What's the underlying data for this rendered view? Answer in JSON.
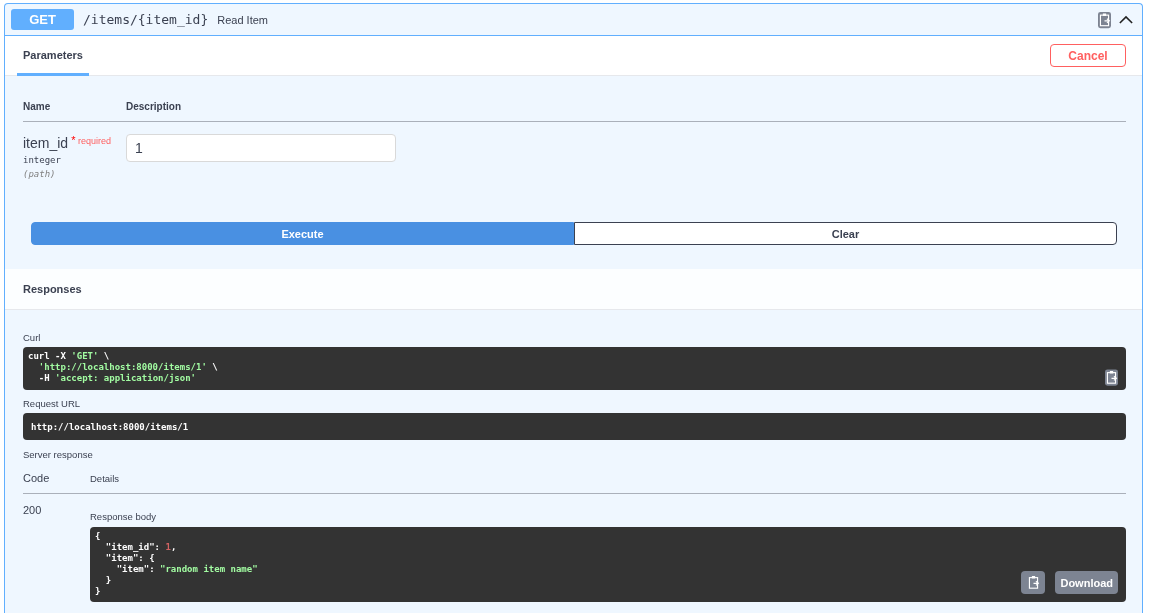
{
  "operation": {
    "method": "GET",
    "path": "/items/{item_id}",
    "summary": "Read Item",
    "expanded": true
  },
  "tabs": [
    {
      "label": "Parameters",
      "selected": true
    }
  ],
  "cancel_button": "Cancel",
  "parameters": {
    "columns": [
      "Name",
      "Description"
    ],
    "rows": [
      {
        "name": "item_id",
        "required_mark": "*",
        "required_label": "required",
        "type": "integer",
        "location": "(path)",
        "value": "1"
      }
    ]
  },
  "execute_button": "Execute",
  "clear_button": "Clear",
  "responses_title": "Responses",
  "curl": {
    "label": "Curl",
    "lines": [
      [
        {
          "text": "curl -X ",
          "kind": "plain"
        },
        {
          "text": "'GET'",
          "kind": "string"
        },
        {
          "text": " \\",
          "kind": "plain"
        }
      ],
      [
        {
          "text": "  'http://localhost:8000/items/1'",
          "kind": "string"
        },
        {
          "text": " \\",
          "kind": "plain"
        }
      ],
      [
        {
          "text": "  -H ",
          "kind": "plain"
        },
        {
          "text": "'accept: application/json'",
          "kind": "string"
        }
      ]
    ]
  },
  "request_url": {
    "label": "Request URL",
    "value": "http://localhost:8000/items/1"
  },
  "server_response": {
    "label": "Server response",
    "columns": [
      "Code",
      "Details"
    ],
    "rows": [
      {
        "code": "200",
        "body_label": "Response body",
        "download_button": "Download",
        "lines": [
          [
            {
              "text": "{",
              "kind": "plain"
            }
          ],
          [
            {
              "text": "  \"item_id\": ",
              "kind": "plain"
            },
            {
              "text": "1",
              "kind": "number"
            },
            {
              "text": ",",
              "kind": "plain"
            }
          ],
          [
            {
              "text": "  \"item\": {",
              "kind": "plain"
            }
          ],
          [
            {
              "text": "    \"item\": ",
              "kind": "plain"
            },
            {
              "text": "\"random item name\"",
              "kind": "string"
            }
          ],
          [
            {
              "text": "  }",
              "kind": "plain"
            }
          ],
          [
            {
              "text": "}",
              "kind": "plain"
            }
          ]
        ]
      }
    ]
  }
}
